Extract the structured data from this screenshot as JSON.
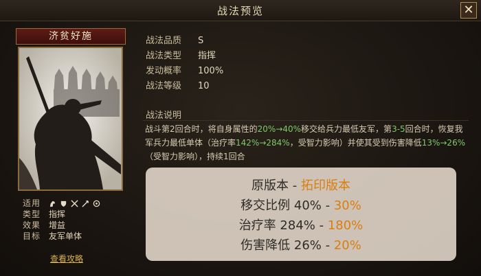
{
  "window": {
    "title": "战法预览",
    "close_label": "✕"
  },
  "skill": {
    "name": "济贫好施",
    "attributes": {
      "quality_label": "战法品质",
      "quality": "S",
      "type_label": "战法类型",
      "type": "指挥",
      "rate_label": "发动概率",
      "rate": "100%",
      "level_label": "战法等级",
      "level": "10"
    },
    "description_title": "战法说明",
    "description": {
      "p1": "战斗第2回合时，将自身属性的",
      "p2": "20%→40%",
      "p3": "移交给兵力最低友军，第",
      "p4": "3-5",
      "p5": "回合时，恢复我军兵力最低单体（治疗率",
      "p6": "142%→284%",
      "p7": "，受智力影响）并使其受到伤害降低",
      "p8": "13%→26%",
      "p9": "（受智力影响），持续1回合"
    }
  },
  "info": {
    "applicable_label": "适用",
    "applicable_icons": [
      "horse-icon",
      "shield-icon",
      "crossed-swords-icon",
      "spear-icon",
      "crossbow-icon"
    ],
    "type_label": "类型",
    "type_value": "指挥",
    "effect_label": "效果",
    "effect_value": "增益",
    "target_label": "目标",
    "target_value": "友军单体",
    "guide_link": "查看攻略"
  },
  "overlay": {
    "line1_a": "原版本",
    "line1_sep": " - ",
    "line1_b": "拓印版本",
    "line2_a": "移交比例 40%",
    "line2_sep": " - ",
    "line2_b": "30%",
    "line3_a": "治疗率 284%",
    "line3_sep": " - ",
    "line3_b": "180%",
    "line4_a": "伤害降低 26%",
    "line4_sep": " - ",
    "line4_b": "20%"
  },
  "colors": {
    "accent": "#d97e10",
    "green": "#7fc96b",
    "link": "#d8b24f"
  }
}
